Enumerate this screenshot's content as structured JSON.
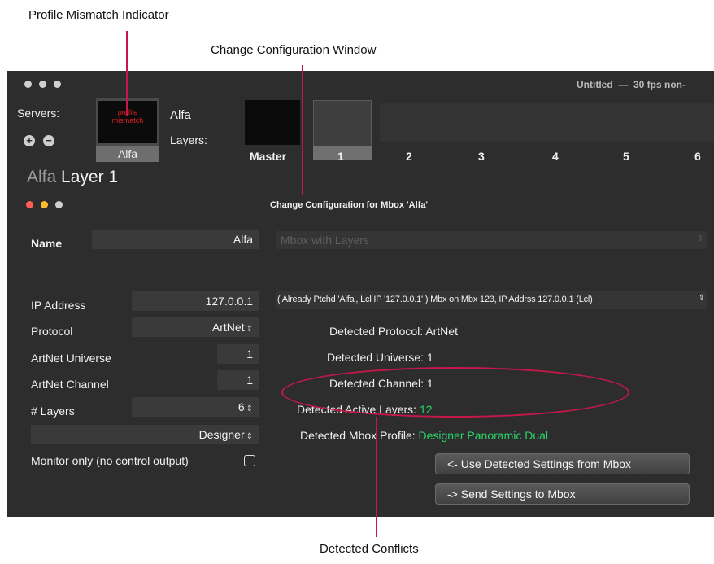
{
  "callouts": {
    "profile_mismatch": "Profile Mismatch Indicator",
    "change_config": "Change Configuration Window",
    "detected_conflicts": "Detected Conflicts"
  },
  "window": {
    "title": "Untitled  —  30 fps non-"
  },
  "servers": {
    "label": "Servers:",
    "thumb_text_line1": "profile",
    "thumb_text_line2": "mismatch",
    "thumb_caption": "Alfa",
    "name": "Alfa",
    "layers_label": "Layers:",
    "add_symbol": "+",
    "remove_symbol": "−"
  },
  "layers": {
    "tabs": [
      "Master",
      "1",
      "2",
      "3",
      "4",
      "5",
      "6"
    ],
    "selected": "1"
  },
  "heading": {
    "server": "Alfa",
    "layer": "Layer 1"
  },
  "dialog": {
    "title": "Change Configuration for Mbox 'Alfa'",
    "name_label": "Name",
    "name_value": "Alfa",
    "mbox_select_placeholder": "Mbox with Layers",
    "ip_label": "IP Address",
    "ip_value": "127.0.0.1",
    "ip_select": "( Already Ptchd 'Alfa', Lcl IP '127.0.0.1' ) Mbx on Mbx 123, IP Addrss 127.0.0.1 (Lcl)",
    "protocol_label": "Protocol",
    "protocol_value": "ArtNet",
    "universe_label": "ArtNet Universe",
    "universe_value": "1",
    "channel_label": "ArtNet Channel",
    "channel_value": "1",
    "layers_label": "# Layers",
    "layers_value": "6",
    "profile_value": "Designer",
    "monitor_label": "Monitor only (no control output)",
    "monitor_checked": false,
    "detected": {
      "protocol_label": "Detected Protocol:",
      "protocol_value": "ArtNet",
      "universe_label": "Detected Universe:",
      "universe_value": "1",
      "channel_label": "Detected Channel:",
      "channel_value": "1",
      "active_layers_label": "Detected Active Layers:",
      "active_layers_value": "12",
      "profile_label": "Detected Mbox Profile:",
      "profile_value": "Designer Panoramic Dual"
    },
    "use_detected_button": "<- Use Detected Settings from Mbox",
    "send_button": "-> Send Settings to Mbox"
  },
  "colors": {
    "callout_line": "#c4184a",
    "detected_green": "#29d46a",
    "mismatch_red": "#e02020"
  }
}
